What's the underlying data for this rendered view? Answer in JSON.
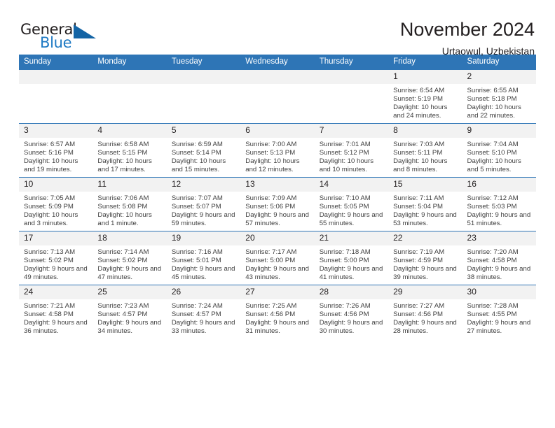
{
  "brand": {
    "name_part1": "General",
    "name_part2": "Blue",
    "accent_color": "#1464a5",
    "blue_text_color": "#1f7ac4"
  },
  "header": {
    "title": "November 2024",
    "subtitle": "Urtaowul, Uzbekistan"
  },
  "calendar": {
    "header_bg": "#2e75b6",
    "daynum_bg": "#f2f2f2",
    "weekdays": [
      "Sunday",
      "Monday",
      "Tuesday",
      "Wednesday",
      "Thursday",
      "Friday",
      "Saturday"
    ],
    "weeks": [
      [
        {
          "day": "",
          "sunrise": "",
          "sunset": "",
          "daylight": ""
        },
        {
          "day": "",
          "sunrise": "",
          "sunset": "",
          "daylight": ""
        },
        {
          "day": "",
          "sunrise": "",
          "sunset": "",
          "daylight": ""
        },
        {
          "day": "",
          "sunrise": "",
          "sunset": "",
          "daylight": ""
        },
        {
          "day": "",
          "sunrise": "",
          "sunset": "",
          "daylight": ""
        },
        {
          "day": "1",
          "sunrise": "Sunrise: 6:54 AM",
          "sunset": "Sunset: 5:19 PM",
          "daylight": "Daylight: 10 hours and 24 minutes."
        },
        {
          "day": "2",
          "sunrise": "Sunrise: 6:55 AM",
          "sunset": "Sunset: 5:18 PM",
          "daylight": "Daylight: 10 hours and 22 minutes."
        }
      ],
      [
        {
          "day": "3",
          "sunrise": "Sunrise: 6:57 AM",
          "sunset": "Sunset: 5:16 PM",
          "daylight": "Daylight: 10 hours and 19 minutes."
        },
        {
          "day": "4",
          "sunrise": "Sunrise: 6:58 AM",
          "sunset": "Sunset: 5:15 PM",
          "daylight": "Daylight: 10 hours and 17 minutes."
        },
        {
          "day": "5",
          "sunrise": "Sunrise: 6:59 AM",
          "sunset": "Sunset: 5:14 PM",
          "daylight": "Daylight: 10 hours and 15 minutes."
        },
        {
          "day": "6",
          "sunrise": "Sunrise: 7:00 AM",
          "sunset": "Sunset: 5:13 PM",
          "daylight": "Daylight: 10 hours and 12 minutes."
        },
        {
          "day": "7",
          "sunrise": "Sunrise: 7:01 AM",
          "sunset": "Sunset: 5:12 PM",
          "daylight": "Daylight: 10 hours and 10 minutes."
        },
        {
          "day": "8",
          "sunrise": "Sunrise: 7:03 AM",
          "sunset": "Sunset: 5:11 PM",
          "daylight": "Daylight: 10 hours and 8 minutes."
        },
        {
          "day": "9",
          "sunrise": "Sunrise: 7:04 AM",
          "sunset": "Sunset: 5:10 PM",
          "daylight": "Daylight: 10 hours and 5 minutes."
        }
      ],
      [
        {
          "day": "10",
          "sunrise": "Sunrise: 7:05 AM",
          "sunset": "Sunset: 5:09 PM",
          "daylight": "Daylight: 10 hours and 3 minutes."
        },
        {
          "day": "11",
          "sunrise": "Sunrise: 7:06 AM",
          "sunset": "Sunset: 5:08 PM",
          "daylight": "Daylight: 10 hours and 1 minute."
        },
        {
          "day": "12",
          "sunrise": "Sunrise: 7:07 AM",
          "sunset": "Sunset: 5:07 PM",
          "daylight": "Daylight: 9 hours and 59 minutes."
        },
        {
          "day": "13",
          "sunrise": "Sunrise: 7:09 AM",
          "sunset": "Sunset: 5:06 PM",
          "daylight": "Daylight: 9 hours and 57 minutes."
        },
        {
          "day": "14",
          "sunrise": "Sunrise: 7:10 AM",
          "sunset": "Sunset: 5:05 PM",
          "daylight": "Daylight: 9 hours and 55 minutes."
        },
        {
          "day": "15",
          "sunrise": "Sunrise: 7:11 AM",
          "sunset": "Sunset: 5:04 PM",
          "daylight": "Daylight: 9 hours and 53 minutes."
        },
        {
          "day": "16",
          "sunrise": "Sunrise: 7:12 AM",
          "sunset": "Sunset: 5:03 PM",
          "daylight": "Daylight: 9 hours and 51 minutes."
        }
      ],
      [
        {
          "day": "17",
          "sunrise": "Sunrise: 7:13 AM",
          "sunset": "Sunset: 5:02 PM",
          "daylight": "Daylight: 9 hours and 49 minutes."
        },
        {
          "day": "18",
          "sunrise": "Sunrise: 7:14 AM",
          "sunset": "Sunset: 5:02 PM",
          "daylight": "Daylight: 9 hours and 47 minutes."
        },
        {
          "day": "19",
          "sunrise": "Sunrise: 7:16 AM",
          "sunset": "Sunset: 5:01 PM",
          "daylight": "Daylight: 9 hours and 45 minutes."
        },
        {
          "day": "20",
          "sunrise": "Sunrise: 7:17 AM",
          "sunset": "Sunset: 5:00 PM",
          "daylight": "Daylight: 9 hours and 43 minutes."
        },
        {
          "day": "21",
          "sunrise": "Sunrise: 7:18 AM",
          "sunset": "Sunset: 5:00 PM",
          "daylight": "Daylight: 9 hours and 41 minutes."
        },
        {
          "day": "22",
          "sunrise": "Sunrise: 7:19 AM",
          "sunset": "Sunset: 4:59 PM",
          "daylight": "Daylight: 9 hours and 39 minutes."
        },
        {
          "day": "23",
          "sunrise": "Sunrise: 7:20 AM",
          "sunset": "Sunset: 4:58 PM",
          "daylight": "Daylight: 9 hours and 38 minutes."
        }
      ],
      [
        {
          "day": "24",
          "sunrise": "Sunrise: 7:21 AM",
          "sunset": "Sunset: 4:58 PM",
          "daylight": "Daylight: 9 hours and 36 minutes."
        },
        {
          "day": "25",
          "sunrise": "Sunrise: 7:23 AM",
          "sunset": "Sunset: 4:57 PM",
          "daylight": "Daylight: 9 hours and 34 minutes."
        },
        {
          "day": "26",
          "sunrise": "Sunrise: 7:24 AM",
          "sunset": "Sunset: 4:57 PM",
          "daylight": "Daylight: 9 hours and 33 minutes."
        },
        {
          "day": "27",
          "sunrise": "Sunrise: 7:25 AM",
          "sunset": "Sunset: 4:56 PM",
          "daylight": "Daylight: 9 hours and 31 minutes."
        },
        {
          "day": "28",
          "sunrise": "Sunrise: 7:26 AM",
          "sunset": "Sunset: 4:56 PM",
          "daylight": "Daylight: 9 hours and 30 minutes."
        },
        {
          "day": "29",
          "sunrise": "Sunrise: 7:27 AM",
          "sunset": "Sunset: 4:56 PM",
          "daylight": "Daylight: 9 hours and 28 minutes."
        },
        {
          "day": "30",
          "sunrise": "Sunrise: 7:28 AM",
          "sunset": "Sunset: 4:55 PM",
          "daylight": "Daylight: 9 hours and 27 minutes."
        }
      ]
    ]
  }
}
